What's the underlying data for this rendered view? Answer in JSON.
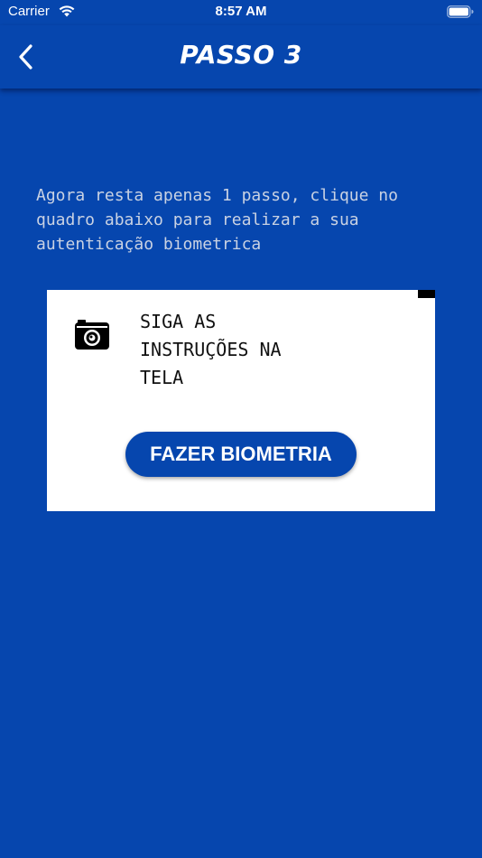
{
  "status_bar": {
    "carrier": "Carrier",
    "time": "8:57 AM",
    "icons": [
      "wifi-icon",
      "battery-icon"
    ]
  },
  "nav": {
    "title": "PASSO 3",
    "back_icon": "chevron-left-icon"
  },
  "instruction_text": "Agora resta apenas 1 passo, clique no quadro abaixo para realizar a sua autenticação biometrica",
  "card": {
    "icon": "camera-icon",
    "text": "SIGA AS INSTRUÇÕES NA TELA",
    "button_label": "FAZER BIOMETRIA"
  },
  "colors": {
    "background": "#0646AE",
    "card": "#FFFFFF",
    "button": "#0646AE",
    "text_light": "#C9D2E3"
  }
}
